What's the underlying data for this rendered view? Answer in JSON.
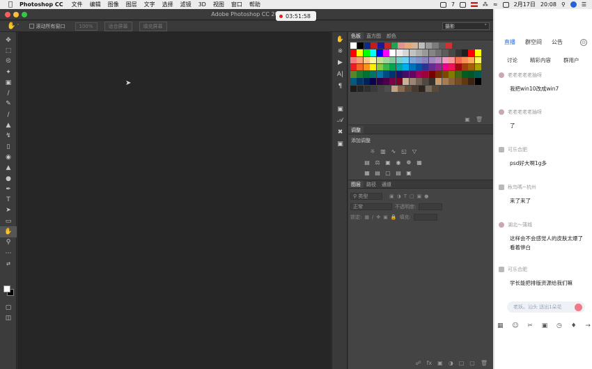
{
  "menubar": {
    "app_name": "Photoshop CC",
    "menus": [
      "文件",
      "编辑",
      "图像",
      "图层",
      "文字",
      "选择",
      "滤镜",
      "3D",
      "视图",
      "窗口",
      "帮助"
    ],
    "badge": "7",
    "date": "2月17日",
    "time": "20:08"
  },
  "photoshop": {
    "window_title": "Adobe Photoshop CC 201",
    "recording_time": "03:51:58",
    "options": {
      "scroll_all_label": "滚动所有窗口",
      "zoom_100_label": "100%",
      "fit_screen_label": "适合屏幕",
      "fill_screen_label": "填充屏幕",
      "workspace_label": "摄影"
    },
    "swatches_tabs": [
      "色板",
      "直方图",
      "颜色"
    ],
    "adjust_tabs": [
      "调整"
    ],
    "adjust_add_label": "添加调整",
    "layers_tabs": [
      "图层",
      "路径",
      "通道"
    ],
    "layers": {
      "filter_label": "类型",
      "blend_mode": "正常",
      "opacity_label": "不透明度:",
      "lock_label": "锁定:",
      "fill_label": "填充:"
    }
  },
  "swatch_rows": [
    [
      "#ffffff",
      "#000000",
      "#0c2a8c",
      "#c21d1d",
      "#1a1a9c",
      "#c52727",
      "#23a050",
      "#e49191",
      "#e0aa7a",
      "#d6b493",
      "#bdbdbd",
      "#9a9a9a",
      "#7c7c7c",
      "#5c5c5c",
      "#d03030"
    ],
    [
      "#ff0000",
      "#ffff00",
      "#00ff00",
      "#00ffff",
      "#0000ff",
      "#ff00ff",
      "#ffffff",
      "#ebebeb",
      "#d6d6d6",
      "#c2c2c2",
      "#adadad",
      "#999999",
      "#858585",
      "#707070",
      "#5c5c5c",
      "#474747",
      "#333333",
      "#1f1f1f",
      "#ff0000",
      "#ffff00"
    ],
    [
      "#f47b7b",
      "#f69f79",
      "#fac78a",
      "#fff799",
      "#c5df89",
      "#a2d39c",
      "#82ca9d",
      "#7bcdc8",
      "#6dcff6",
      "#7ea7d8",
      "#8493ca",
      "#8882be",
      "#a187be",
      "#bc8dbf",
      "#f49ac2",
      "#f6989d",
      "#f26c4f",
      "#f68e56",
      "#fbaf5d",
      "#fff568"
    ],
    [
      "#ed1c24",
      "#f26522",
      "#f7941d",
      "#fff200",
      "#8dc73f",
      "#39b54a",
      "#00a651",
      "#00a99d",
      "#00aeef",
      "#0072bc",
      "#0054a6",
      "#2e3192",
      "#662d91",
      "#92278f",
      "#ec008c",
      "#ed145b",
      "#9e0b0f",
      "#a0410d",
      "#a3620a",
      "#aba000"
    ],
    [
      "#598527",
      "#1a7b30",
      "#007236",
      "#00746b",
      "#0076a3",
      "#004b80",
      "#003471",
      "#1b1464",
      "#440e62",
      "#630460",
      "#9e005d",
      "#9e0039",
      "#790000",
      "#7b2e00",
      "#7d4900",
      "#827b00",
      "#406618",
      "#005e20",
      "#005826",
      "#005952"
    ],
    [
      "#005b7f",
      "#003663",
      "#002157",
      "#0d004c",
      "#32004b",
      "#4b0049",
      "#7b0046",
      "#7a0026",
      "#c7b299",
      "#998675",
      "#736357",
      "#534741",
      "#37302a",
      "#c69c6d",
      "#a67c52",
      "#8c6239",
      "#754c24",
      "#603913",
      "#3c2415",
      "#000000"
    ],
    [
      "#1c1c1c",
      "#262626",
      "#303030",
      "#3a3a3a",
      "#444444",
      "#4e4e4e",
      "#c2a387",
      "#8a6b50",
      "#604a38",
      "#4a3a2e",
      "#2e241c",
      "#7a6a5a",
      "#5a4a3a"
    ]
  ],
  "chat": {
    "tabs": [
      "直播",
      "群空间",
      "公告"
    ],
    "sub_tabs": [
      "讨论",
      "精彩内容",
      "群用户"
    ],
    "messages": [
      {
        "user": "老老老老老抽呀",
        "text": "我把win10改成win7"
      },
      {
        "user": "老老老老老抽呀",
        "text": "了"
      },
      {
        "user": "可乐合肥",
        "text": "psd好大啊1g多"
      },
      {
        "user": "秋鸟嗎~杭州",
        "text": "来了来了"
      },
      {
        "user": "湖北～蒲城",
        "text": "这样会不会感觉人的皮肤太爆了 看着慘白"
      },
      {
        "user": "可乐合肥",
        "text": "学长能把排版资源给我们嘛"
      }
    ],
    "input_placeholder": "老妖。汕头 送出1朵花"
  },
  "colors": {
    "accent_blue": "#2a6fe0",
    "ps_bg": "#323232",
    "canvas": "#262626"
  }
}
